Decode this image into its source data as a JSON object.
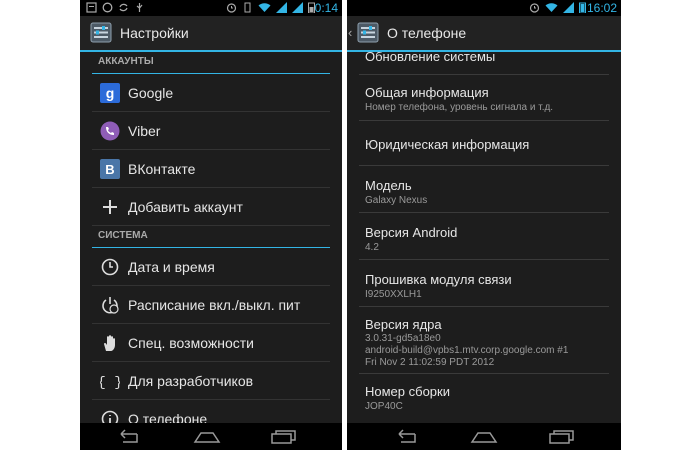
{
  "left_screen": {
    "status_time": "0:14",
    "title": "Настройки",
    "sections": [
      {
        "header": "АККАУНТЫ",
        "items": [
          {
            "label": "Google",
            "icon": "google-icon"
          },
          {
            "label": "Viber",
            "icon": "viber-icon"
          },
          {
            "label": "ВКонтакте",
            "icon": "vk-icon"
          },
          {
            "label": "Добавить аккаунт",
            "icon": "plus-icon"
          }
        ]
      },
      {
        "header": "СИСТЕМА",
        "items": [
          {
            "label": "Дата и время",
            "icon": "clock-icon"
          },
          {
            "label": "Расписание вкл./выкл. пит",
            "icon": "power-schedule-icon"
          },
          {
            "label": "Спец. возможности",
            "icon": "hand-icon"
          },
          {
            "label": "Для разработчиков",
            "icon": "braces-icon"
          },
          {
            "label": "О телефоне",
            "icon": "info-icon"
          }
        ]
      }
    ]
  },
  "right_screen": {
    "status_time": "16:02",
    "title": "О телефоне",
    "items": [
      {
        "title": "Обновление системы",
        "lines": []
      },
      {
        "title": "Общая информация",
        "lines": [
          "Номер телефона, уровень сигнала и т.д."
        ]
      },
      {
        "title": "Юридическая информация",
        "lines": []
      },
      {
        "title": "Модель",
        "lines": [
          "Galaxy Nexus"
        ]
      },
      {
        "title": "Версия Android",
        "lines": [
          "4.2"
        ]
      },
      {
        "title": "Прошивка модуля связи",
        "lines": [
          "I9250XXLH1"
        ]
      },
      {
        "title": "Версия ядра",
        "lines": [
          "3.0.31-gd5a18e0",
          "android-build@vpbs1.mtv.corp.google.com #1",
          "Fri Nov 2 11:02:59 PDT 2012"
        ]
      },
      {
        "title": "Номер сборки",
        "lines": [
          "JOP40C"
        ]
      }
    ]
  },
  "colors": {
    "accent": "#33b5e5",
    "background": "#1d1d1d"
  }
}
